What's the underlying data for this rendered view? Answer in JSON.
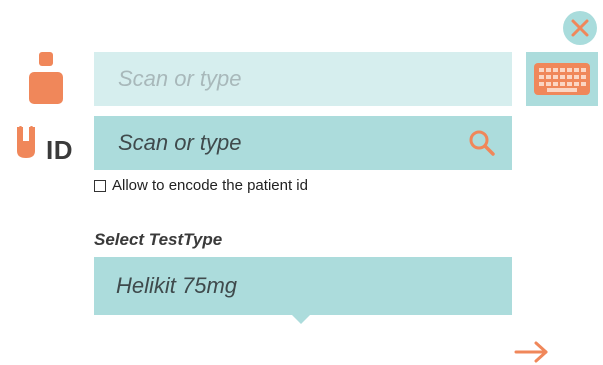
{
  "colors": {
    "accent": "#f0875a",
    "field_light": "#d6eeee",
    "field": "#acdcdc",
    "close_bg": "#a9dcdc",
    "text_dark": "#3a3a3a"
  },
  "icons": {
    "close": "close-icon",
    "person": "person-icon",
    "keyboard": "keyboard-icon",
    "id_badge": "id-badge-icon",
    "search": "search-icon",
    "next": "arrow-right-icon"
  },
  "patient_name": {
    "placeholder": "Scan or type",
    "value": ""
  },
  "patient_id": {
    "label": "ID",
    "placeholder": "Scan or type",
    "value": ""
  },
  "encode_checkbox": {
    "label": "Allow to encode the patient id",
    "checked": false
  },
  "test_type": {
    "label": "Select TestType",
    "selected": "Helikit 75mg"
  }
}
